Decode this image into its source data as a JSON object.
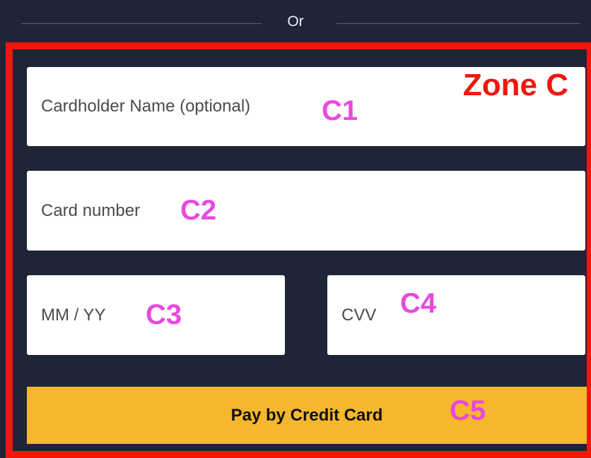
{
  "divider": {
    "text": "Or"
  },
  "zone": {
    "label": "Zone C",
    "accent_color": "#f0170d"
  },
  "fields": {
    "cardholder": {
      "placeholder": "Cardholder Name (optional)",
      "tag": "C1"
    },
    "card_number": {
      "placeholder": "Card number",
      "tag": "C2"
    },
    "expiry": {
      "placeholder": "MM / YY",
      "tag": "C3"
    },
    "cvv": {
      "placeholder": "CVV",
      "tag": "C4"
    }
  },
  "pay_button": {
    "label": "Pay by Credit Card",
    "tag": "C5",
    "color": "#f5b72d"
  },
  "tag_color": "#e64ae0"
}
